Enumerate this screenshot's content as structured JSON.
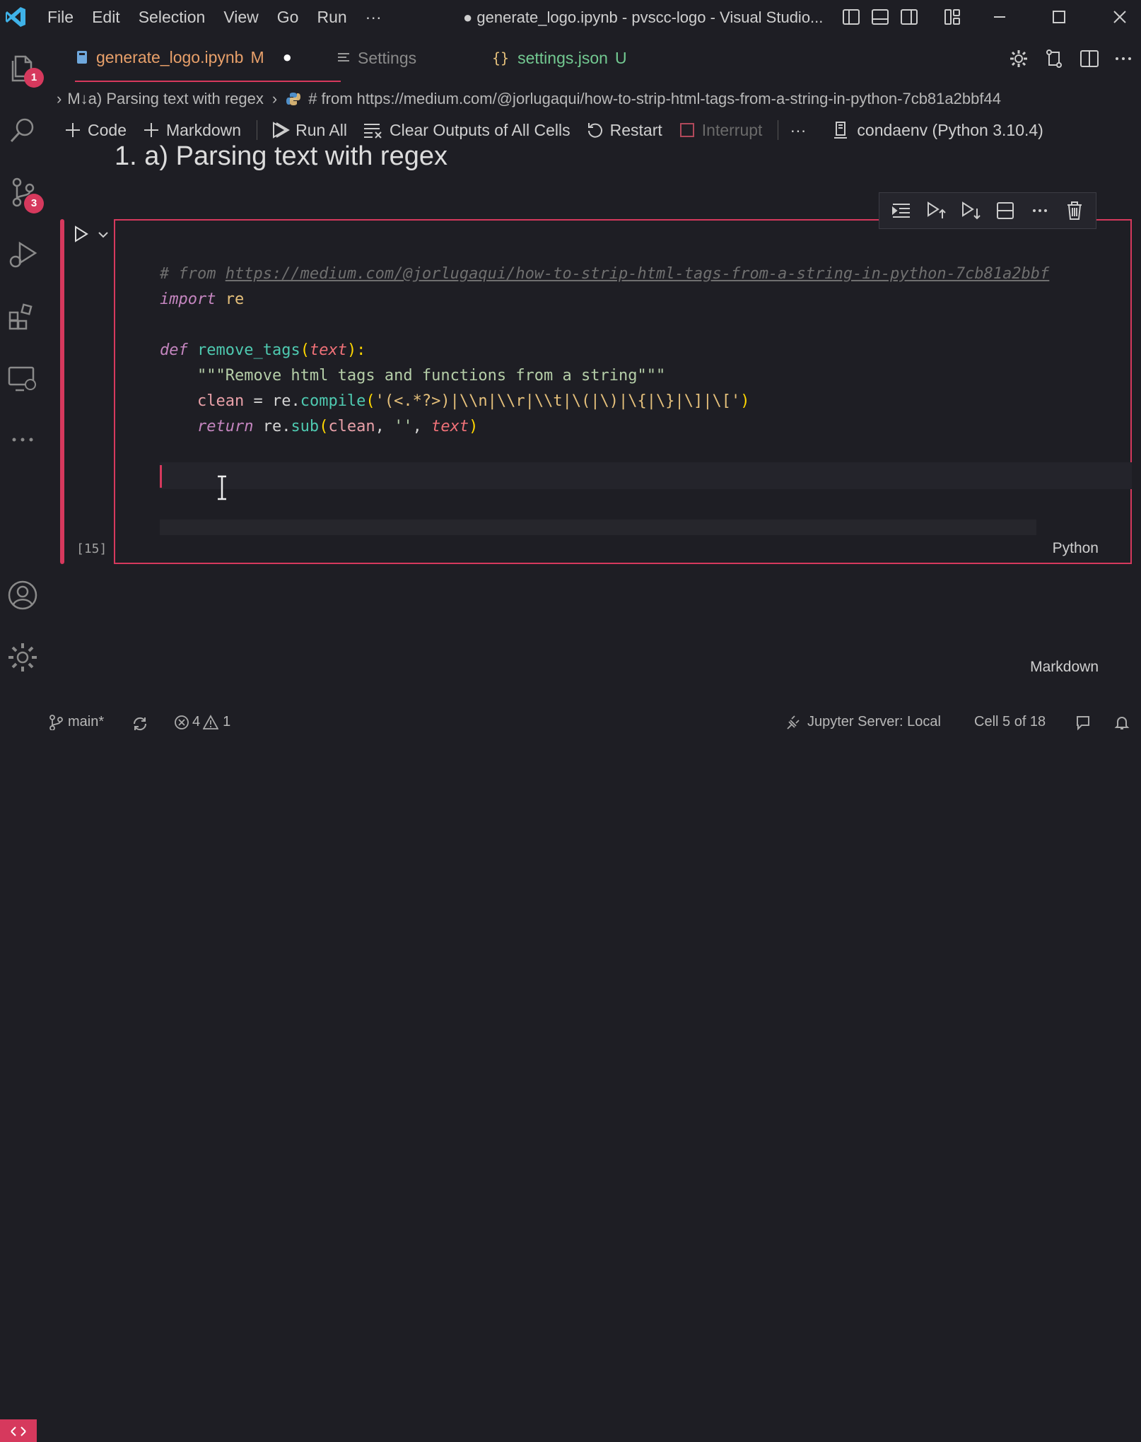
{
  "menu": [
    "File",
    "Edit",
    "Selection",
    "View",
    "Go",
    "Run",
    "···"
  ],
  "window_title": "● generate_logo.ipynb - pvscc-logo - Visual Studio...",
  "badges": {
    "explorer": "1",
    "scm": "3"
  },
  "tabs": [
    {
      "label": "generate_logo.ipynb",
      "suffix": "M",
      "dirty": "●"
    },
    {
      "label": "Settings"
    },
    {
      "label": "settings.json",
      "suffix": "U"
    }
  ],
  "breadcrumb": {
    "part1": "M↓a) Parsing text with regex",
    "part2": "# from https://medium.com/@jorlugaqui/how-to-strip-html-tags-from-a-string-in-python-7cb81a2bbf44"
  },
  "toolbar": {
    "code": "Code",
    "markdown": "Markdown",
    "run_all": "Run All",
    "clear": "Clear Outputs of All Cells",
    "restart": "Restart",
    "interrupt": "Interrupt",
    "more": "···",
    "kernel": "condaenv (Python 3.10.4)"
  },
  "heading": "1. a) Parsing text with regex",
  "cell": {
    "exec_count": "[15]",
    "language": "Python",
    "lines": {
      "l1_comment": "# from ",
      "l1_url": "https://medium.com/@jorlugaqui/how-to-strip-html-tags-from-a-string-in-python-7cb81a2bbf",
      "l2_kw": "import",
      "l2_mod": " re",
      "l4_kw": "def",
      "l4_fn": " remove_tags",
      "l4_p1": "(",
      "l4_param": "text",
      "l4_p2": "):",
      "l5": "    \"\"\"Remove html tags and functions from a string\"\"\"",
      "l6_var": "    clean",
      "l6_eq": " = re.",
      "l6_fn": "compile",
      "l6_p": "(",
      "l6_str": "'(<.*?>)|\\\\n|\\\\r|\\\\t|\\(|\\)|\\{|\\}|\\]|\\['",
      "l6_pe": ")",
      "l7_kw": "    return",
      "l7_a": " re.",
      "l7_fn": "sub",
      "l7_b": "(",
      "l7_var": "clean",
      "l7_c": ", ",
      "l7_str": "''",
      "l7_d": ", ",
      "l7_param": "text",
      "l7_e": ")"
    }
  },
  "md_cell": {
    "language": "Markdown"
  },
  "status": {
    "branch": "main*",
    "errors": "4",
    "warnings": "1",
    "jupyter": "Jupyter Server: Local",
    "cell": "Cell 5 of 18"
  }
}
